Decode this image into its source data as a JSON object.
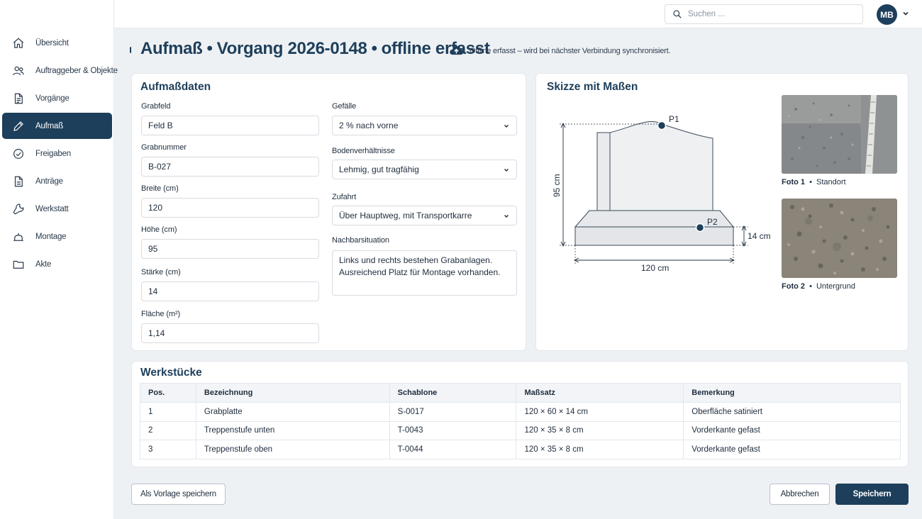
{
  "nav": [
    {
      "label": "Übersicht",
      "icon": "home-icon"
    },
    {
      "label": "Auftraggeber & Objekte",
      "icon": "users-icon"
    },
    {
      "label": "Vorgänge",
      "icon": "document-icon"
    },
    {
      "label": "Aufmaß",
      "icon": "pencil-icon",
      "active": true
    },
    {
      "label": "Freigaben",
      "icon": "check-circle-icon"
    },
    {
      "label": "Anträge",
      "icon": "file-icon"
    },
    {
      "label": "Werkstatt",
      "icon": "wrench-icon"
    },
    {
      "label": "Montage",
      "icon": "hand-icon"
    },
    {
      "label": "Akte",
      "icon": "folder-icon"
    }
  ],
  "topbar": {
    "search_placeholder": "Suchen ...",
    "user_initials": "MB"
  },
  "header": {
    "part1": "Aufmaß",
    "sep": "•",
    "part2": "Vorgang 2026-0148",
    "part3": "offline erfasst",
    "sync_status": "Offline erfasst – wird bei nächster Verbindung synchronisiert."
  },
  "form": {
    "title": "Aufmaßdaten",
    "grabfeld": {
      "label": "Grabfeld",
      "value": "Feld B"
    },
    "grabnummer": {
      "label": "Grabnummer",
      "value": "B-027"
    },
    "breite": {
      "label": "Breite (cm)",
      "value": "120"
    },
    "hoehe": {
      "label": "Höhe (cm)",
      "value": "95"
    },
    "staerke": {
      "label": "Stärke (cm)",
      "value": "14"
    },
    "flaeche": {
      "label": "Fläche (m²)",
      "value": "1,14"
    },
    "gefaelle": {
      "label": "Gefälle",
      "value": "2 % nach vorne"
    },
    "boden": {
      "label": "Bodenverhältnisse",
      "value": "Lehmig, gut tragfähig"
    },
    "zufahrt": {
      "label": "Zufahrt",
      "value": "Über Hauptweg, mit Transportkarre"
    },
    "nachbar": {
      "label": "Nachbarsituation",
      "line1": "Links und rechts bestehen Grabanlagen.",
      "line2": "Ausreichend Platz für Montage vorhanden."
    }
  },
  "sketch": {
    "title": "Skizze mit Maßen",
    "p1": "P1",
    "p2": "P2",
    "height_label": "95 cm",
    "thickness_label": "14 cm",
    "width_label": "120 cm",
    "photos": [
      {
        "label": "Foto 1",
        "sep": "•",
        "caption": "Standort"
      },
      {
        "label": "Foto 2",
        "sep": "•",
        "caption": "Untergrund"
      }
    ]
  },
  "workpieces": {
    "title": "Werkstücke",
    "headers": [
      "Pos.",
      "Bezeichnung",
      "Schablone",
      "Maßsatz",
      "Bemerkung"
    ],
    "rows": [
      [
        "1",
        "Grabplatte",
        "S-0017",
        "120 × 60 × 14 cm",
        "Oberfläche satiniert"
      ],
      [
        "2",
        "Treppenstufe unten",
        "T-0043",
        "120 × 35 × 8 cm",
        "Vorderkante gefast"
      ],
      [
        "3",
        "Treppenstufe oben",
        "T-0044",
        "120 × 35 × 8 cm",
        "Vorderkante gefast"
      ]
    ]
  },
  "actions": {
    "template": "Als Vorlage speichern",
    "cancel": "Abbrechen",
    "save": "Speichern"
  },
  "colors": {
    "primary": "#1e3f5b",
    "background": "#eef1f4"
  }
}
